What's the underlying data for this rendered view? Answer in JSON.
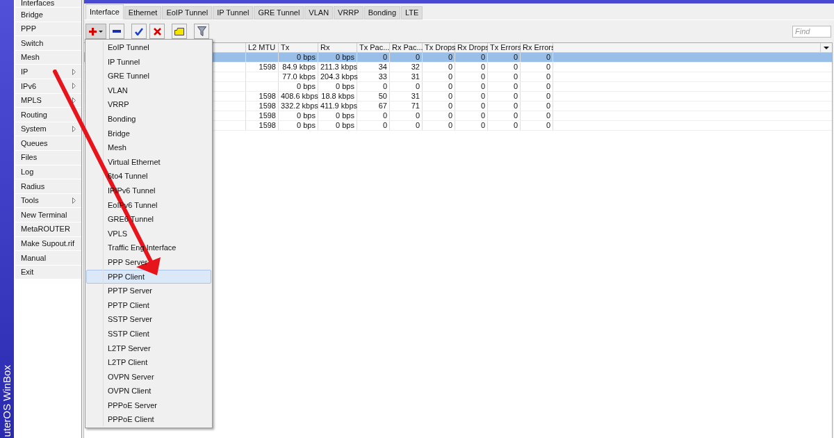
{
  "side_label": "uterOS WinBox",
  "sidebar": {
    "items": [
      {
        "label": "Interfaces",
        "submenu": false
      },
      {
        "label": "Bridge",
        "submenu": false
      },
      {
        "label": "PPP",
        "submenu": false
      },
      {
        "label": "Switch",
        "submenu": false
      },
      {
        "label": "Mesh",
        "submenu": false
      },
      {
        "label": "IP",
        "submenu": true
      },
      {
        "label": "IPv6",
        "submenu": true
      },
      {
        "label": "MPLS",
        "submenu": true
      },
      {
        "label": "Routing",
        "submenu": false
      },
      {
        "label": "System",
        "submenu": true
      },
      {
        "label": "Queues",
        "submenu": false
      },
      {
        "label": "Files",
        "submenu": false
      },
      {
        "label": "Log",
        "submenu": false
      },
      {
        "label": "Radius",
        "submenu": false
      },
      {
        "label": "Tools",
        "submenu": true
      },
      {
        "label": "New Terminal",
        "submenu": false
      },
      {
        "label": "MetaROUTER",
        "submenu": false
      },
      {
        "label": "Make Supout.rif",
        "submenu": false
      },
      {
        "label": "Manual",
        "submenu": false
      },
      {
        "label": "Exit",
        "submenu": false
      }
    ]
  },
  "tabs": [
    {
      "label": "Interface",
      "selected": true
    },
    {
      "label": "Ethernet",
      "selected": false
    },
    {
      "label": "EoIP Tunnel",
      "selected": false
    },
    {
      "label": "IP Tunnel",
      "selected": false
    },
    {
      "label": "GRE Tunnel",
      "selected": false
    },
    {
      "label": "VLAN",
      "selected": false
    },
    {
      "label": "VRRP",
      "selected": false
    },
    {
      "label": "Bonding",
      "selected": false
    },
    {
      "label": "LTE",
      "selected": false
    }
  ],
  "toolbar": [
    {
      "kind": "add"
    },
    {
      "kind": "remove"
    },
    {
      "kind": "enable"
    },
    {
      "kind": "disable"
    },
    {
      "kind": "comment"
    },
    {
      "kind": "filter"
    }
  ],
  "search": {
    "placeholder": "Find"
  },
  "table": {
    "columns": [
      "",
      "L2 MTU",
      "Tx",
      "Rx",
      "Tx Pac...",
      "Rx Pac...",
      "Tx Drops",
      "Rx Drops",
      "Tx Errors",
      "Rx Errors"
    ],
    "rows": [
      {
        "selected": true,
        "cells": [
          "",
          "",
          "0 bps",
          "0 bps",
          "0",
          "0",
          "0",
          "0",
          "0",
          "0"
        ]
      },
      {
        "selected": false,
        "cells": [
          "",
          "1598",
          "84.9 kbps",
          "211.3 kbps",
          "34",
          "32",
          "0",
          "0",
          "0",
          "0"
        ]
      },
      {
        "selected": false,
        "cells": [
          "",
          "",
          "77.0 kbps",
          "204.3 kbps",
          "33",
          "31",
          "0",
          "0",
          "0",
          "0"
        ]
      },
      {
        "selected": false,
        "cells": [
          "",
          "",
          "0 bps",
          "0 bps",
          "0",
          "0",
          "0",
          "0",
          "0",
          "0"
        ]
      },
      {
        "selected": false,
        "cells": [
          "",
          "1598",
          "408.6 kbps",
          "18.8 kbps",
          "50",
          "31",
          "0",
          "0",
          "0",
          "0"
        ]
      },
      {
        "selected": false,
        "cells": [
          "",
          "1598",
          "332.2 kbps",
          "411.9 kbps",
          "67",
          "71",
          "0",
          "0",
          "0",
          "0"
        ]
      },
      {
        "selected": false,
        "cells": [
          "",
          "1598",
          "0 bps",
          "0 bps",
          "0",
          "0",
          "0",
          "0",
          "0",
          "0"
        ]
      },
      {
        "selected": false,
        "cells": [
          "",
          "1598",
          "0 bps",
          "0 bps",
          "0",
          "0",
          "0",
          "0",
          "0",
          "0"
        ]
      }
    ]
  },
  "add_menu": {
    "items": [
      {
        "label": "EoIP Tunnel",
        "selected": false
      },
      {
        "label": "IP Tunnel",
        "selected": false
      },
      {
        "label": "GRE Tunnel",
        "selected": false
      },
      {
        "label": "VLAN",
        "selected": false
      },
      {
        "label": "VRRP",
        "selected": false
      },
      {
        "label": "Bonding",
        "selected": false
      },
      {
        "label": "Bridge",
        "selected": false
      },
      {
        "label": "Mesh",
        "selected": false
      },
      {
        "label": "Virtual Ethernet",
        "selected": false
      },
      {
        "label": "6to4 Tunnel",
        "selected": false
      },
      {
        "label": "IPIPv6 Tunnel",
        "selected": false
      },
      {
        "label": "EoIPv6 Tunnel",
        "selected": false
      },
      {
        "label": "GRE6 Tunnel",
        "selected": false
      },
      {
        "label": "VPLS",
        "selected": false
      },
      {
        "label": "Traffic Eng Interface",
        "selected": false
      },
      {
        "label": "PPP Server",
        "selected": false
      },
      {
        "label": "PPP Client",
        "selected": true
      },
      {
        "label": "PPTP Server",
        "selected": false
      },
      {
        "label": "PPTP Client",
        "selected": false
      },
      {
        "label": "SSTP Server",
        "selected": false
      },
      {
        "label": "SSTP Client",
        "selected": false
      },
      {
        "label": "L2TP Server",
        "selected": false
      },
      {
        "label": "L2TP Client",
        "selected": false
      },
      {
        "label": "OVPN Server",
        "selected": false
      },
      {
        "label": "OVPN Client",
        "selected": false
      },
      {
        "label": "PPPoE Server",
        "selected": false
      },
      {
        "label": "PPPoE Client",
        "selected": false
      }
    ]
  }
}
